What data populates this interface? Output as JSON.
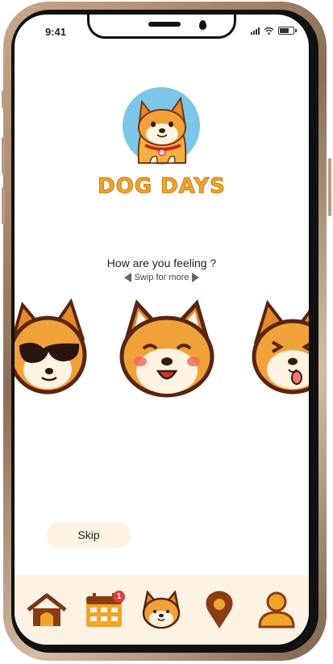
{
  "status_bar": {
    "time": "9:41"
  },
  "brand": {
    "title": "DOG DAYS"
  },
  "mood": {
    "question": "How are you feeling ?",
    "hint": "Swip for more",
    "options": [
      "cool-dog-face-icon",
      "happy-dog-face-icon",
      "winking-dog-face-icon"
    ],
    "selected_index": 1
  },
  "skip_label": "Skip",
  "tabbar": {
    "items": [
      "home-icon",
      "calendar-icon",
      "dog-face-icon",
      "location-pin-icon",
      "profile-icon"
    ],
    "calendar_badge": "1"
  },
  "colors": {
    "accent": "#f0a52a",
    "accent_dark": "#8a3a12",
    "tab_bg": "#fdf3e4",
    "badge": "#e23a3a"
  }
}
